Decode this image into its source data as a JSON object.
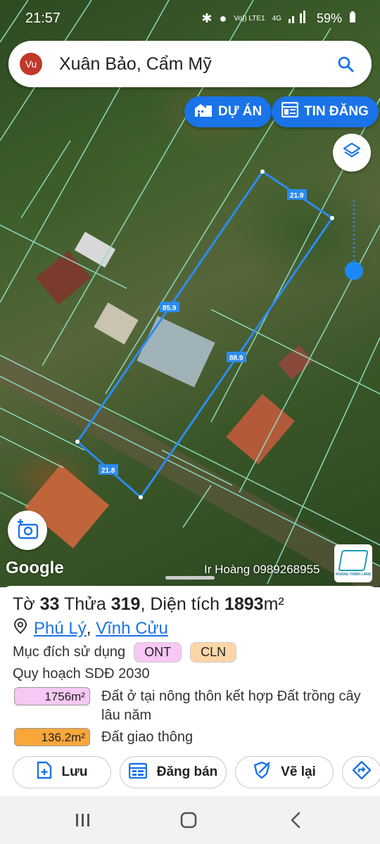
{
  "status_bar": {
    "time": "21:57",
    "volte": "Vo)) LTE1",
    "network": "4G",
    "battery": "59%"
  },
  "search": {
    "avatar_initials": "Vu",
    "location_title": "Xuân Bảo, Cẩm Mỹ"
  },
  "chips": {
    "projects": "DỰ ÁN",
    "listings": "TIN ĐĂNG"
  },
  "map": {
    "edge_labels": [
      "21.9",
      "85.9",
      "88.9",
      "21.8"
    ],
    "attribution": "Google",
    "credit": "Ir Hoàng 0989268955",
    "logo_text": "HOÀNG THỊNH LAND",
    "boundary_color": "#2b8cf0"
  },
  "parcel": {
    "sheet_label": "Tờ",
    "sheet_no": "33",
    "plot_label": "Thửa",
    "plot_no": "319",
    "area_label": "Diện tích",
    "area_value": "1893",
    "area_unit": "m²",
    "ward": "Phú Lý",
    "district": "Vĩnh Cửu",
    "purpose_label": "Mục đích sử dụng",
    "purpose_tags": [
      "ONT",
      "CLN"
    ],
    "planning_title": "Quy hoạch SDĐ 2030",
    "planning": [
      {
        "area": "1756m²",
        "desc": "Đất ở tại nông thôn kết hợp Đất trồng cây lâu năm",
        "color": "#f6c8f3"
      },
      {
        "area": "136.2m²",
        "desc": "Đất giao thông",
        "color": "#f9a63a"
      }
    ]
  },
  "actions": {
    "save": "Lưu",
    "sell": "Đăng bán",
    "redraw": "Vẽ lại"
  }
}
